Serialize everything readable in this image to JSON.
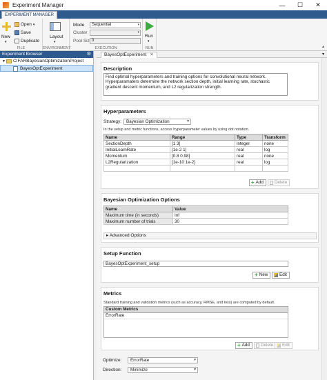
{
  "window": {
    "title": "Experiment Manager",
    "min": "—",
    "max": "☐",
    "close": "✕"
  },
  "toolstrip": {
    "tab": "EXPERIMENT MANAGER",
    "file": {
      "new": "New",
      "open": "Open",
      "save": "Save",
      "duplicate": "Duplicate",
      "caption": "FILE"
    },
    "environment": {
      "layout": "Layout",
      "caption": "ENVIRONMENT"
    },
    "execution": {
      "mode_label": "Mode",
      "mode_value": "Sequential",
      "cluster_label": "Cluster",
      "cluster_value": "",
      "pool_label": "Pool Size",
      "pool_value": "0",
      "caption": "EXECUTION"
    },
    "run": {
      "label": "Run",
      "caption": "RUN"
    }
  },
  "browser": {
    "title": "Experiment Browser",
    "project": "CIFARBayesianOptimizationProject",
    "experiment": "BayesOptExperiment"
  },
  "editor": {
    "tab": "BayesOptExperiment",
    "description": {
      "heading": "Description",
      "text": "Find optimal hyperparameters and training options for convolutional neural network. Hyperparamaters determine the network section depth, initial learning rate, stochastic gradient descent momentum, and L2 regularization strength."
    },
    "hyperparameters": {
      "heading": "Hyperparameters",
      "strategy_label": "Strategy:",
      "strategy_value": "Bayesian Optimization",
      "note": "In the setup and metric functions, access hyperparameter values by using dot notation.",
      "columns": [
        "Name",
        "Range",
        "Type",
        "Transform"
      ],
      "rows": [
        [
          "SectionDepth",
          "[1 3]",
          "integer",
          "none"
        ],
        [
          "InitialLearnRate",
          "[1e-2 1]",
          "real",
          "log"
        ],
        [
          "Momentum",
          "[0.8 0.98]",
          "real",
          "none"
        ],
        [
          "L2Regularization",
          "[1e-10 1e-2]",
          "real",
          "log"
        ]
      ],
      "add": "Add",
      "delete": "Delete"
    },
    "bayes": {
      "heading": "Bayesian Optimization Options",
      "columns": [
        "Name",
        "Value"
      ],
      "rows": [
        [
          "Maximum time (in seconds)",
          "Inf"
        ],
        [
          "Maximum number of trials",
          "30"
        ]
      ],
      "advanced": "Advanced Options"
    },
    "setup": {
      "heading": "Setup Function",
      "value": "BayesOptExperiment_setup",
      "new": "New",
      "edit": "Edit"
    },
    "metrics": {
      "heading": "Metrics",
      "note": "Standard training and validation metrics (such as accuracy, RMSE, and loss) are computed by default.",
      "column": "Custom Metrics",
      "items": [
        "ErrorRate"
      ],
      "add": "Add",
      "delete": "Delete",
      "edit": "Edit"
    },
    "optimize": {
      "label": "Optimize:",
      "value": "ErrorRate"
    },
    "direction": {
      "label": "Direction:",
      "value": "Minimize"
    }
  }
}
